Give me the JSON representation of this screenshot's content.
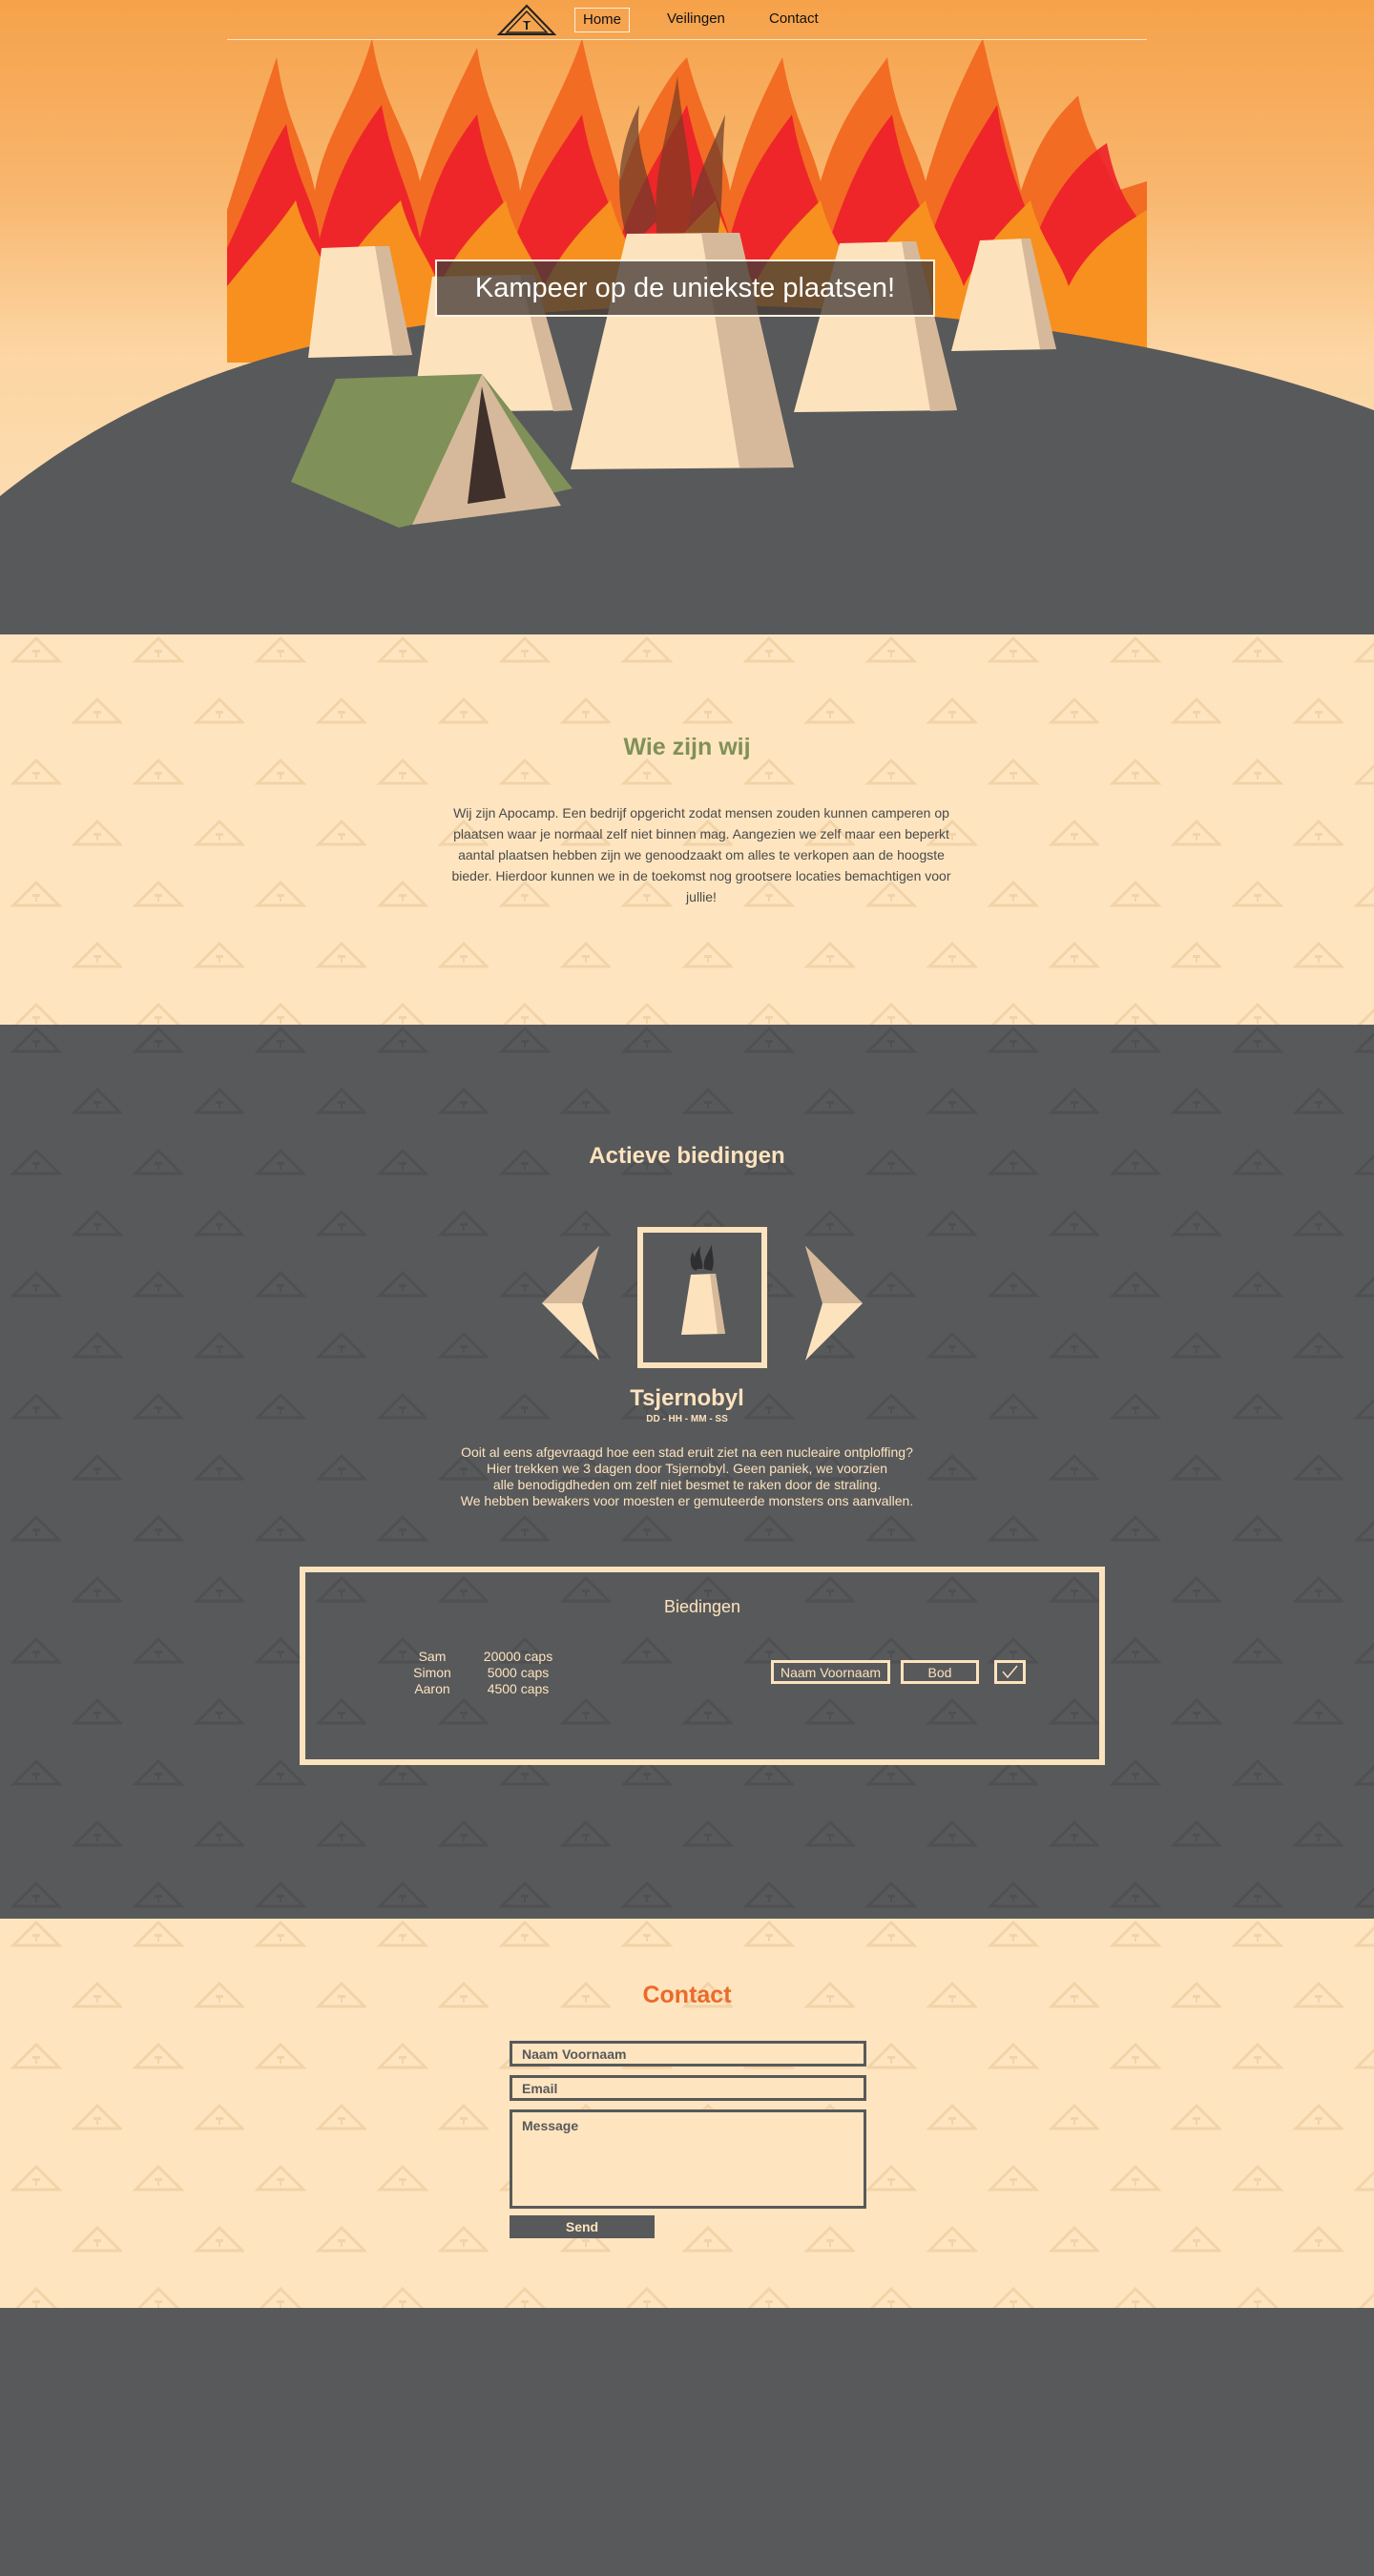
{
  "nav": {
    "items": [
      {
        "label": "Home",
        "active": true
      },
      {
        "label": "Veilingen",
        "active": false
      },
      {
        "label": "Contact",
        "active": false
      }
    ]
  },
  "hero": {
    "title": "Kampeer op de uniekste plaatsen!"
  },
  "about": {
    "title": "Wie zijn wij",
    "text": "Wij zijn Apocamp. Een bedrijf opgericht zodat mensen zouden kunnen camperen op plaatsen waar je normaal zelf niet binnen mag. Aangezien we zelf maar een beperkt aantal plaatsen hebben zijn we genoodzaakt om alles te verkopen aan de hoogste bieder. Hierdoor kunnen we in de toekomst nog grootsere locaties bemachtigen voor jullie!"
  },
  "auctions": {
    "title": "Actieve biedingen",
    "item_name": "Tsjernobyl",
    "timer": "DD - HH - MM - SS",
    "description_lines": [
      "Ooit al eens afgevraagd hoe  een stad eruit ziet na een nucleaire ontploffing?",
      "Hier trekken we 3 dagen door Tsjernobyl. Geen paniek, we voorzien",
      "alle benodigdheden om zelf niet besmet te raken door de straling.",
      "We hebben bewakers voor moesten er gemuteerde monsters ons aanvallen."
    ],
    "bids_title": "Biedingen",
    "bids": [
      {
        "name": "Sam",
        "amount": "20000 caps"
      },
      {
        "name": "Simon",
        "amount": "5000 caps"
      },
      {
        "name": "Aaron",
        "amount": "4500 caps"
      }
    ],
    "name_placeholder": "Naam Voornaam",
    "bid_placeholder": "Bod"
  },
  "contact": {
    "title": "Contact",
    "name_placeholder": "Naam Voornaam",
    "email_placeholder": "Email",
    "message_placeholder": "Message",
    "send_label": "Send"
  },
  "colors": {
    "cream": "#fee5bf",
    "charcoal": "#58595b",
    "olive": "#7f9059",
    "orange": "#ec6a2b"
  }
}
